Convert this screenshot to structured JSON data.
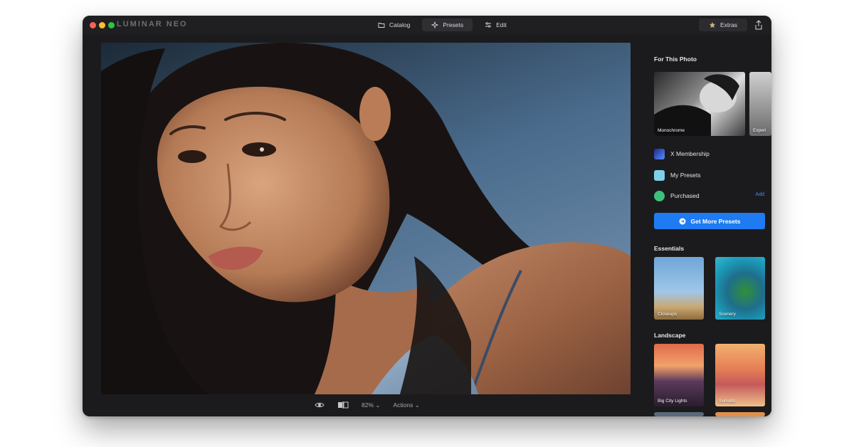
{
  "app": {
    "name": "LUMINAR NEO"
  },
  "nav": {
    "tabs": [
      {
        "label": "Catalog",
        "icon": "folder-icon",
        "active": false
      },
      {
        "label": "Presets",
        "icon": "sparkle-icon",
        "active": true
      },
      {
        "label": "Edit",
        "icon": "sliders-icon",
        "active": false
      }
    ],
    "extras_label": "Extras"
  },
  "viewer": {
    "zoom": "82%",
    "actions_label": "Actions"
  },
  "panel": {
    "for_this_photo_title": "For This Photo",
    "for_this_photo_cards": [
      {
        "label": "Monochrome"
      },
      {
        "label": "Experi"
      }
    ],
    "collections": [
      {
        "label": "X Membership",
        "icon": "x-membership-icon"
      },
      {
        "label": "My Presets",
        "icon": "my-presets-icon"
      },
      {
        "label": "Purchased",
        "icon": "purchased-icon"
      }
    ],
    "add_label": "Add",
    "get_more_label": "Get More Presets",
    "essentials_title": "Essentials",
    "essentials_cards": [
      {
        "label": "Closeups"
      },
      {
        "label": "Scenery"
      }
    ],
    "landscape_title": "Landscape",
    "landscape_cards": [
      {
        "label": "Big City Lights"
      },
      {
        "label": "Sunsets"
      }
    ]
  },
  "colors": {
    "accent": "#1e7bf2",
    "window_bg": "#1b1b1d",
    "link": "#3d8bff"
  }
}
